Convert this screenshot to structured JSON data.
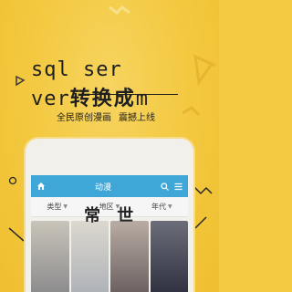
{
  "headline": {
    "line1": "sql ser",
    "line2_prefix": "ver",
    "line2_cjk": "转换成",
    "line2_suffix": "m"
  },
  "subtitle": {
    "part1": "全民原创漫画",
    "part2": "震撼上线"
  },
  "app": {
    "title": "动漫",
    "filters": [
      {
        "label": "类型"
      },
      {
        "label": "地区"
      },
      {
        "label": "年代"
      }
    ],
    "accent_color": "#3fa7d8"
  },
  "overlay": "常 世"
}
